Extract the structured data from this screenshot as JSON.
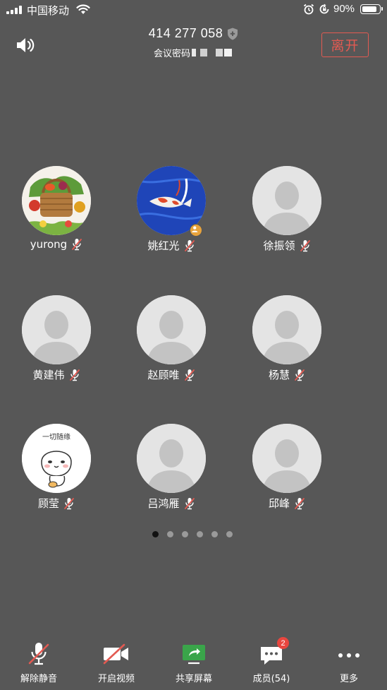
{
  "status_bar": {
    "carrier": "中国移动",
    "battery_percent": "90%",
    "battery_level": 0.9
  },
  "header": {
    "meeting_id": "414 277 058",
    "password_label": "会议密码",
    "leave_label": "离开",
    "speaker_icon": "speaker-icon",
    "shield_icon": "shield-plus-icon"
  },
  "participants": [
    {
      "name": "yurong",
      "avatar": "vegetable-basket-photo",
      "muted": true,
      "host": false
    },
    {
      "name": "姚红光",
      "avatar": "koi-fish-photo",
      "muted": true,
      "host": true
    },
    {
      "name": "徐振领",
      "avatar": "default-person",
      "muted": true,
      "host": false
    },
    {
      "name": "黄建伟",
      "avatar": "default-person",
      "muted": true,
      "host": false
    },
    {
      "name": "赵顾唯",
      "avatar": "default-person",
      "muted": true,
      "host": false
    },
    {
      "name": "杨慧",
      "avatar": "default-person",
      "muted": true,
      "host": false
    },
    {
      "name": "顾莹",
      "avatar": "cartoon-sticker",
      "avatar_text": "一切随缘",
      "muted": true,
      "host": false
    },
    {
      "name": "吕鸿雁",
      "avatar": "default-person",
      "muted": true,
      "host": false
    },
    {
      "name": "邱峰",
      "avatar": "default-person",
      "muted": true,
      "host": false
    }
  ],
  "pager": {
    "pages": 6,
    "current": 1
  },
  "toolbar": {
    "unmute_label": "解除静音",
    "video_label": "开启视频",
    "share_label": "共享屏幕",
    "members_label": "成员(54)",
    "more_label": "更多",
    "chat_badge": "2"
  },
  "colors": {
    "background": "#575757",
    "leave": "#e35a52",
    "share_green": "#3aa54a",
    "badge_red": "#e8463f",
    "host_orange": "#e8a33c"
  }
}
